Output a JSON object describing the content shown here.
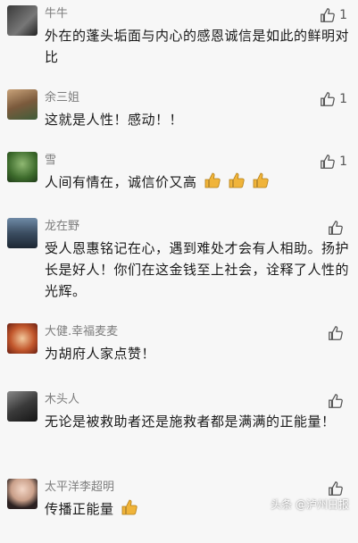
{
  "comments": [
    {
      "name": "牛牛",
      "text": "外在的蓬头垢面与内心的感恩诚信是如此的鲜明对比",
      "likes": "1"
    },
    {
      "name": "余三姐",
      "text": "这就是人性！感动！！",
      "likes": "1"
    },
    {
      "name": "雪",
      "text": "人间有情在，诚信价又高",
      "likes": "1"
    },
    {
      "name": "龙在野",
      "text": "受人恩惠铭记在心，遇到难处才会有人相助。扬护长是好人！你们在这金钱至上社会，诠释了人性的光辉。",
      "likes": ""
    },
    {
      "name": "大健.幸福麦麦",
      "text": "为胡府人家点赞！",
      "likes": ""
    },
    {
      "name": "木头人",
      "text": "无论是被救助者还是施救者都是满满的正能量！",
      "likes": ""
    },
    {
      "name": "太平洋李超明",
      "text": "传播正能量",
      "likes": ""
    }
  ],
  "watermark": "头条 @泸州日报",
  "colors": {
    "name": "#7d7d7d",
    "text": "#1a1a1a",
    "thumb": "#f0b43a"
  }
}
